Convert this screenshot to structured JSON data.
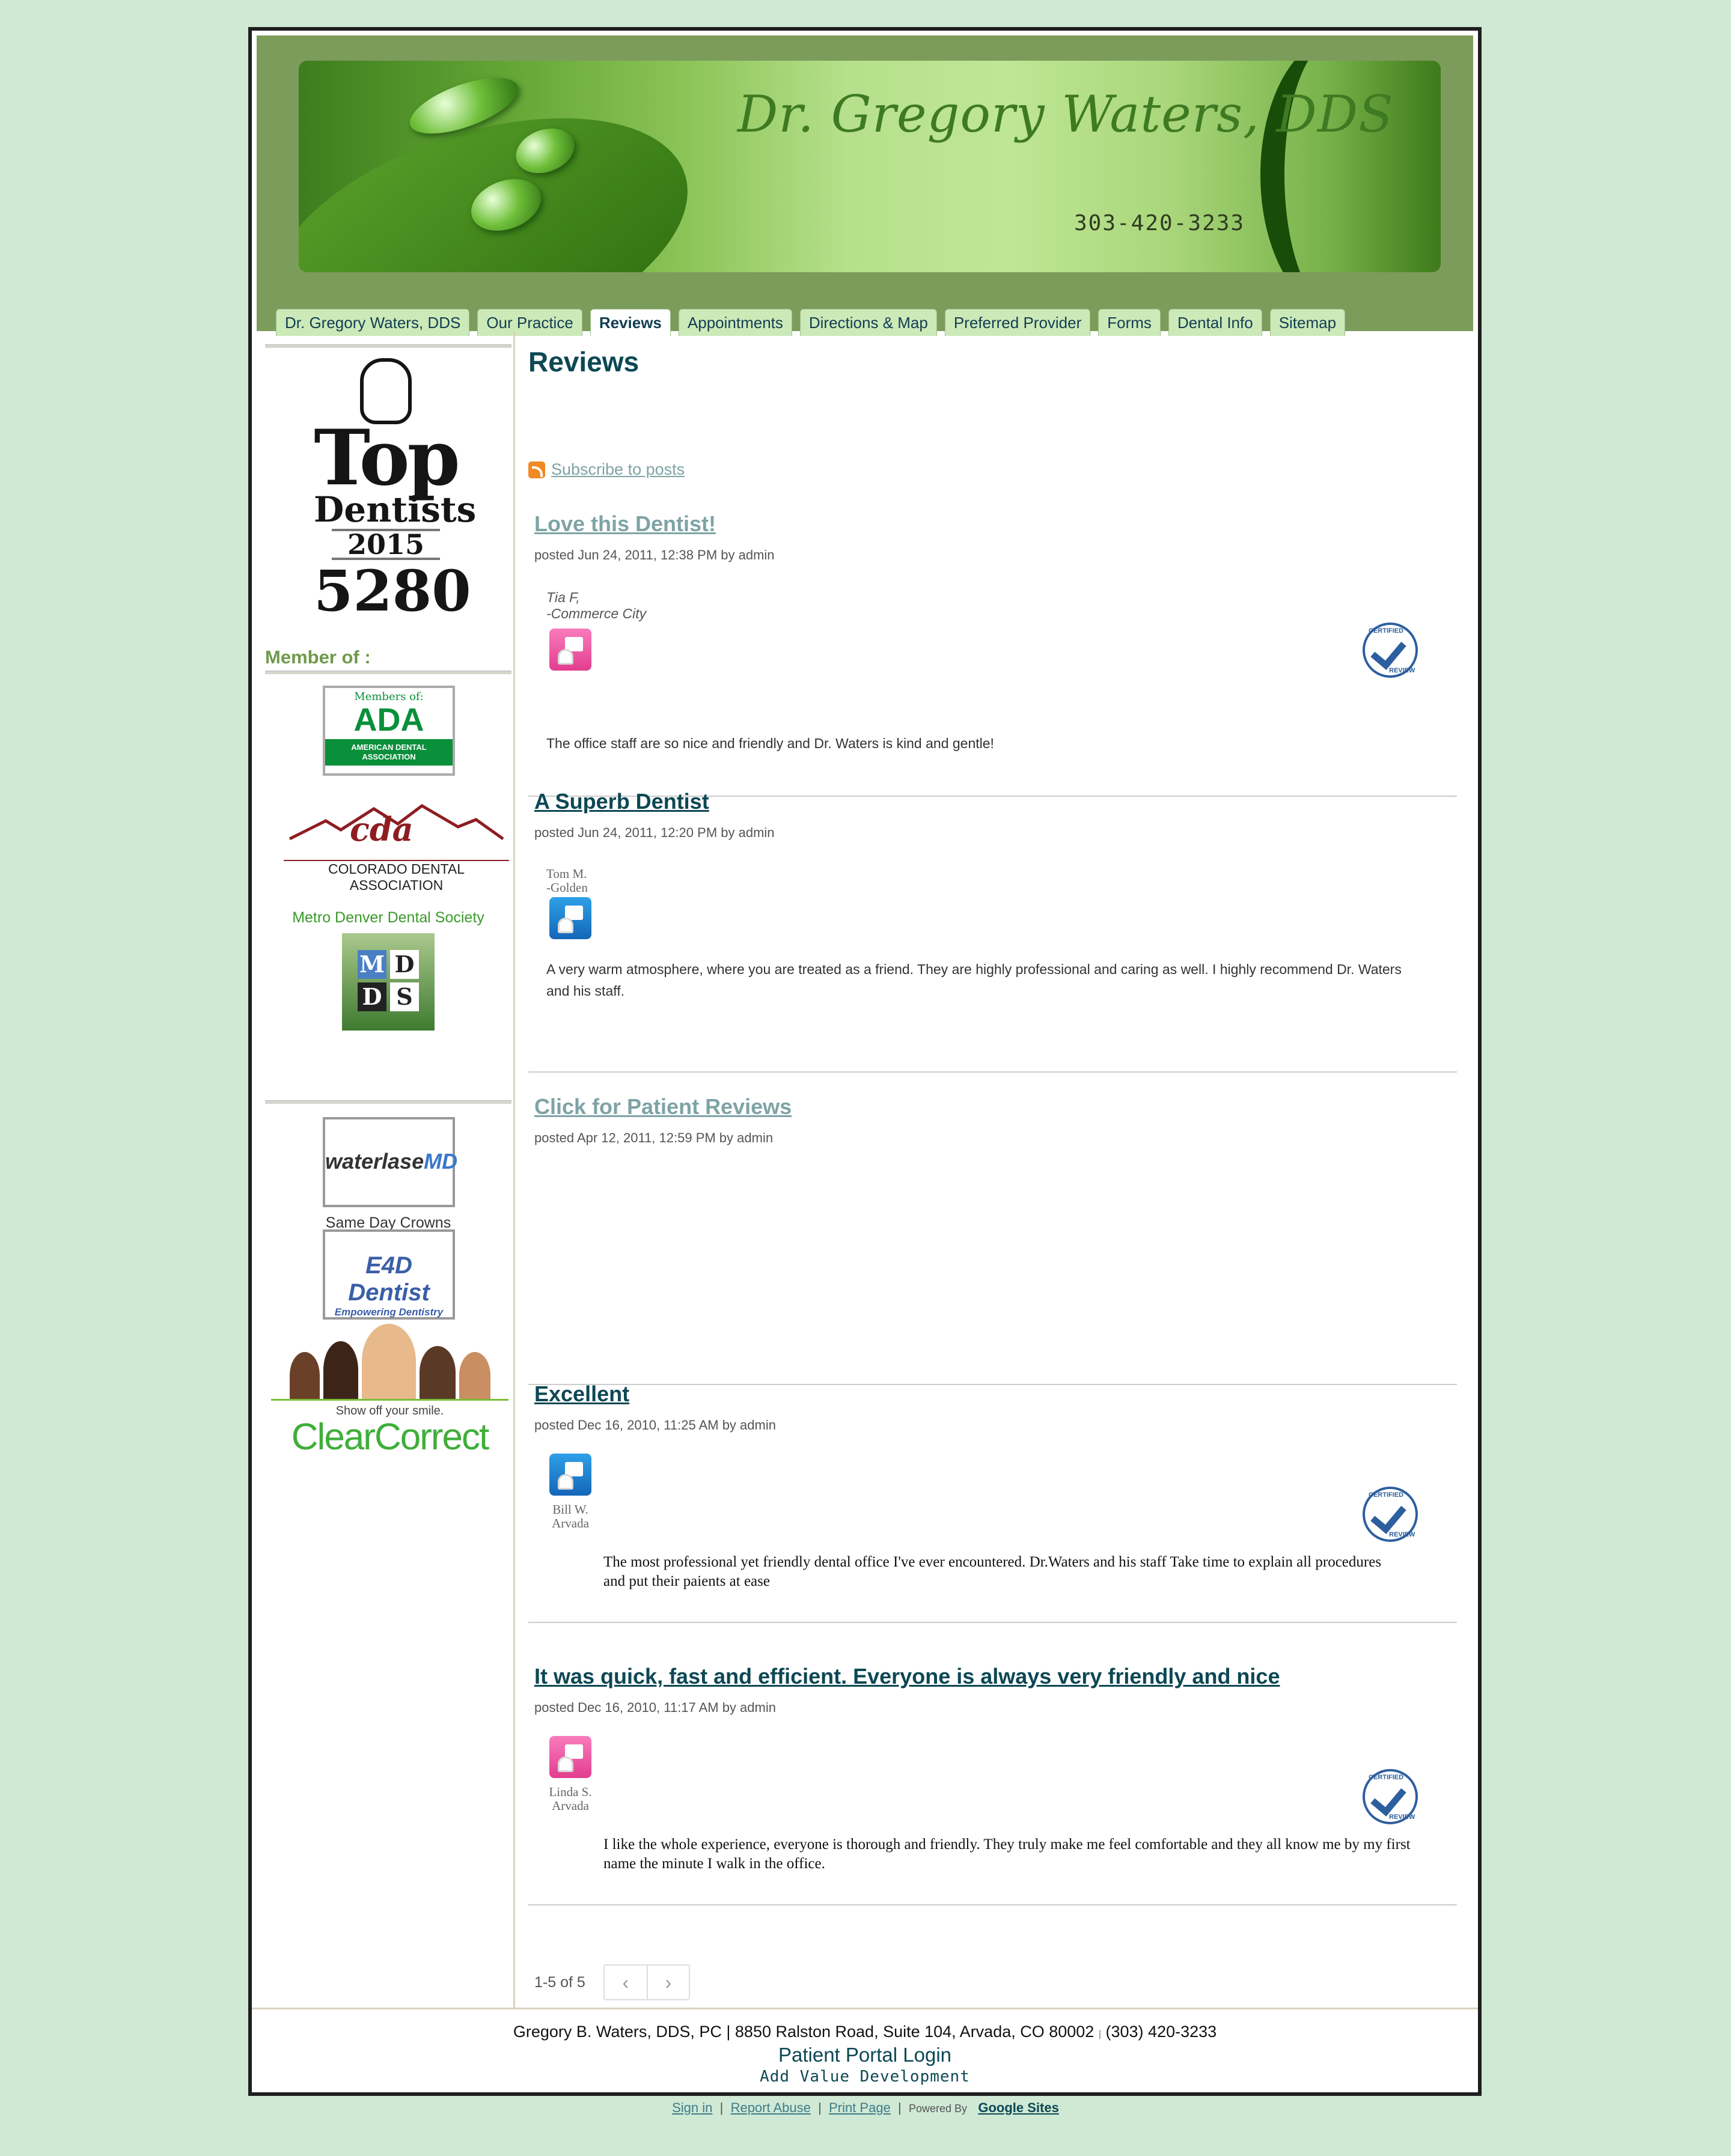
{
  "header": {
    "banner_title": "Dr. Gregory Waters, DDS",
    "banner_phone": "303-420-3233"
  },
  "nav": {
    "tabs": [
      {
        "label": "Dr. Gregory Waters, DDS",
        "active": false
      },
      {
        "label": "Our Practice",
        "active": false
      },
      {
        "label": "Reviews",
        "active": true
      },
      {
        "label": "Appointments",
        "active": false
      },
      {
        "label": "Directions & Map",
        "active": false
      },
      {
        "label": "Preferred Provider",
        "active": false
      },
      {
        "label": "Forms",
        "active": false
      },
      {
        "label": "Dental Info",
        "active": false
      },
      {
        "label": "Sitemap",
        "active": false
      }
    ]
  },
  "sidebar": {
    "top_dentists": {
      "line1": "Top",
      "line2": "Dentists",
      "line3": "2015",
      "line4": "5280"
    },
    "member_title": "Member of :",
    "ada": {
      "top": "Members of:",
      "logo": "ADA",
      "bottom": "AMERICAN DENTAL ASSOCIATION"
    },
    "cda": {
      "logo": "cda",
      "name": "COLORADO DENTAL ASSOCIATION"
    },
    "mdds_label": "Metro Denver Dental Society",
    "mdds_letters": [
      "M",
      "D",
      "D",
      "S"
    ],
    "waterlase": {
      "word": "waterlase",
      "suffix": "MD"
    },
    "crowns_label": "Same Day Crowns",
    "e4d": {
      "logo": "E4D Dentist",
      "tagline": "Empowering Dentistry"
    },
    "clearcorrect": {
      "tagline": "Show off your smile.",
      "logo": "ClearCorrect"
    }
  },
  "main": {
    "page_title": "Reviews",
    "subscribe": "Subscribe to posts",
    "posts": [
      {
        "title": "Love this Dentist!",
        "meta": "posted Jun 24, 2011, 12:38 PM by admin",
        "reviewer_name": "Tia F,",
        "reviewer_place": "-Commerce City",
        "body": "The office staff are so nice and friendly and Dr. Waters is kind and gentle!",
        "avatar_color": "pink",
        "certified": true
      },
      {
        "title": "A Superb Dentist",
        "meta": "posted Jun 24, 2011, 12:20 PM by admin",
        "reviewer_name": "Tom M.",
        "reviewer_place": "-Golden",
        "body": "A very warm atmosphere, where you are treated as a friend. They are highly professional and caring as well. I highly recommend Dr. Waters and his staff.",
        "avatar_color": "blue",
        "certified": false
      },
      {
        "title": "Click for Patient Reviews",
        "meta": "posted Apr 12, 2011, 12:59 PM by admin"
      },
      {
        "title": "Excellent",
        "meta": "posted Dec 16, 2010, 11:25 AM by admin",
        "reviewer_name": "Bill W.",
        "reviewer_place": "Arvada",
        "body": "The most professional yet friendly dental office I've ever encountered.  Dr.Waters and his staff Take time to explain all procedures and put their paients at ease",
        "avatar_color": "blue",
        "certified": true
      },
      {
        "title": "It was quick, fast and efficient. Everyone is always very friendly and nice",
        "meta": "posted Dec 16, 2010, 11:17 AM by admin",
        "reviewer_name": "Linda S.",
        "reviewer_place": "Arvada",
        "body": "I like the whole experience, everyone is thorough and friendly. They truly make me feel comfortable and they all know me by my first name the minute I walk in the office.",
        "avatar_color": "pink",
        "certified": true
      }
    ],
    "certified_text_top": "CERTIFIED",
    "certified_text_bottom": "REVIEW",
    "pager": {
      "count": "1-5 of 5",
      "prev": "‹",
      "next": "›"
    }
  },
  "footer": {
    "address": "Gregory B. Waters, DDS, PC | 8850 Ralston Road, Suite 104, Arvada, CO 80002",
    "phone": "(303) 420-3233",
    "portal": "Patient Portal Login",
    "credit": "Add Value Development"
  },
  "sites_bar": {
    "sign_in": "Sign in",
    "report": "Report Abuse",
    "print": "Print Page",
    "powered": "Powered By",
    "google": "Google Sites"
  },
  "colors": {
    "page_bg": "#cfe9d5",
    "header_bg": "#7c9c5b",
    "tab_bg": "#cce9b8",
    "title_teal": "#0d4854",
    "visited_link": "#7ea3a5"
  }
}
